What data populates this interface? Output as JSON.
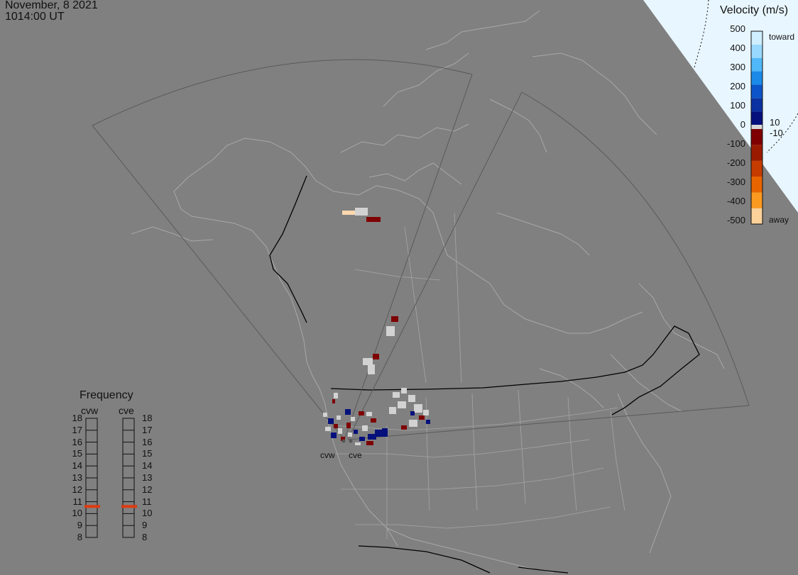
{
  "header": {
    "date": "November, 8 2021",
    "time": "1014:00 UT"
  },
  "colorbar": {
    "title": "Velocity (m/s)",
    "ticks": [
      "500",
      "400",
      "300",
      "200",
      "100",
      "0",
      "-100",
      "-200",
      "-300",
      "-400",
      "-500"
    ],
    "toward_label": "toward",
    "away_label": "away",
    "gap_high": "10",
    "gap_low": "-10",
    "colors": [
      "#cfeeff",
      "#98d8ff",
      "#50b8f8",
      "#1b8ae8",
      "#0c55c8",
      "#0a32a0",
      "#05107c",
      "#d7d7d7",
      "#7e0000",
      "#9a1a00",
      "#c43c00",
      "#e86400",
      "#fa9a20",
      "#fcd29a"
    ]
  },
  "frequency": {
    "title": "Frequency",
    "radars": [
      "cvw",
      "cve"
    ],
    "scale": [
      "18",
      "17",
      "16",
      "15",
      "14",
      "13",
      "12",
      "11",
      "10",
      "9",
      "8"
    ],
    "cvw_mhz": 10.6,
    "cve_mhz": 10.6,
    "marker_color": "#e03a10"
  },
  "sites": {
    "cvw": "cvw",
    "cve": "cve"
  },
  "map_colors": {
    "background": "#808080",
    "lines": "#a6a6a6",
    "fov": "#5c5c5c",
    "border": "#000000",
    "terminator": "#e8f6ff"
  }
}
